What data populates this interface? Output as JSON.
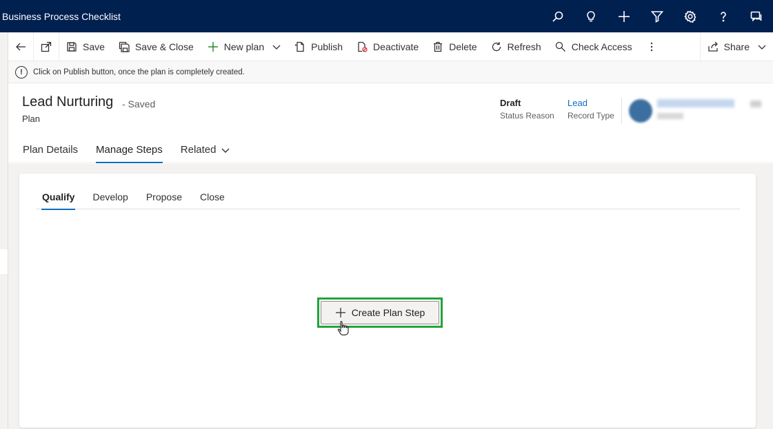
{
  "app": {
    "title": "Business Process Checklist"
  },
  "topbar": {
    "icons": [
      "search-icon",
      "lightbulb-icon",
      "plus-icon",
      "filter-icon",
      "gear-icon",
      "help-icon",
      "chat-icon"
    ]
  },
  "commandbar": {
    "save": "Save",
    "save_close": "Save & Close",
    "new_plan": "New plan",
    "publish": "Publish",
    "deactivate": "Deactivate",
    "delete": "Delete",
    "refresh": "Refresh",
    "check_access": "Check Access",
    "share": "Share"
  },
  "notification": {
    "icon": "!",
    "text": "Click on Publish button, once the plan is completely created."
  },
  "header": {
    "title": "Lead Nurturing",
    "saved_status": "- Saved",
    "entity": "Plan",
    "status_reason_value": "Draft",
    "status_reason_label": "Status Reason",
    "record_type_value": "Lead",
    "record_type_label": "Record Type"
  },
  "tabs": [
    "Plan Details",
    "Manage Steps",
    "Related"
  ],
  "stages": [
    "Qualify",
    "Develop",
    "Propose",
    "Close"
  ],
  "main": {
    "create_button": "Create Plan Step"
  },
  "colors": {
    "topbar": "#002050",
    "accent": "#0f6cbd",
    "highlight": "#22a33a"
  }
}
